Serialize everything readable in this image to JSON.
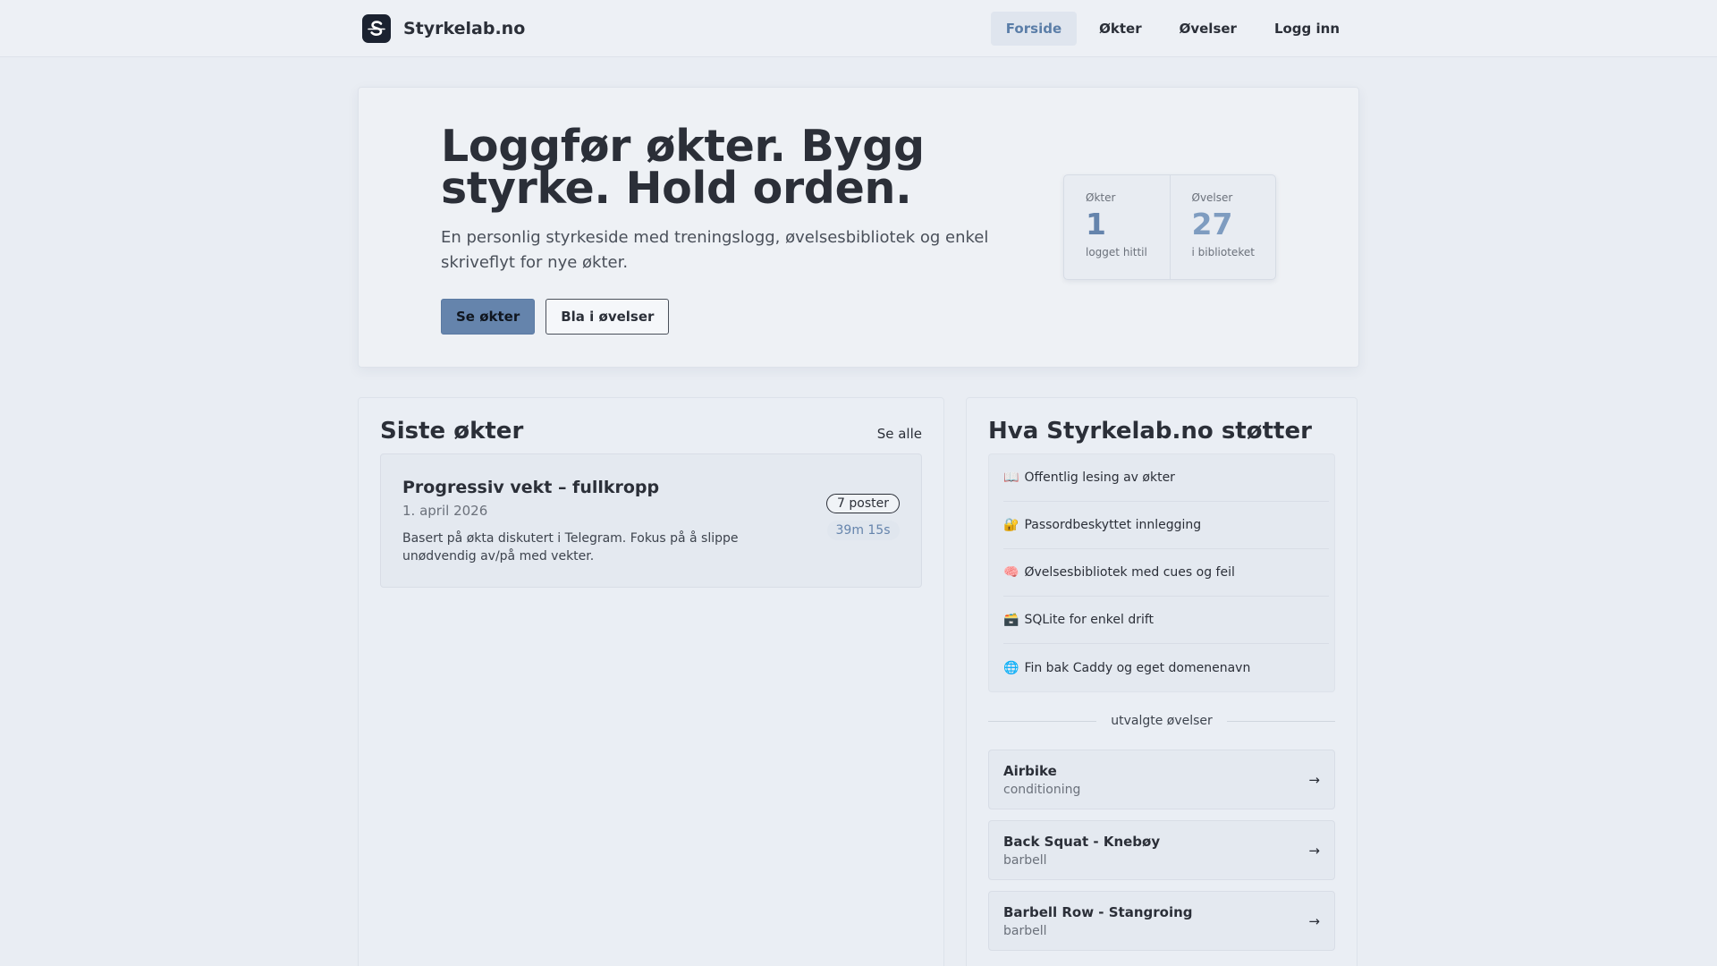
{
  "brand": {
    "name": "Styrkelab.no",
    "logo_icon": "s-logo-icon"
  },
  "nav": [
    {
      "label": "Forside",
      "active": true
    },
    {
      "label": "Økter",
      "active": false
    },
    {
      "label": "Øvelser",
      "active": false
    },
    {
      "label": "Logg inn",
      "active": false
    }
  ],
  "hero": {
    "title": "Loggfør økter. Bygg styrke. Hold orden.",
    "subtitle": "En personlig styrkeside med treningslogg, øvelsesbibliotek og enkel skriveflyt for nye økter.",
    "primary_button": "Se økter",
    "secondary_button": "Bla i øvelser",
    "stats": [
      {
        "label": "Økter",
        "value": "1",
        "sub": "logget hittil"
      },
      {
        "label": "Øvelser",
        "value": "27",
        "sub": "i biblioteket"
      }
    ]
  },
  "recent": {
    "title": "Siste økter",
    "see_all": "Se alle",
    "sessions": [
      {
        "title": "Progressiv vekt – fullkropp",
        "date": "1. april 2026",
        "description": "Basert på økta diskutert i Telegram. Fokus på å slippe unødvendig av/på med vekter.",
        "entries": "7 poster",
        "duration": "39m 15s"
      }
    ]
  },
  "features": {
    "title": "Hva Styrkelab.no støtter",
    "items": [
      {
        "icon": "📖",
        "icon_name": "book-icon",
        "label": "Offentlig lesing av økter"
      },
      {
        "icon": "🔐",
        "icon_name": "lock-icon",
        "label": "Passordbeskyttet innlegging"
      },
      {
        "icon": "🧠",
        "icon_name": "brain-icon",
        "label": "Øvelsesbibliotek med cues og feil"
      },
      {
        "icon": "🗃️",
        "icon_name": "card-box-icon",
        "label": "SQLite for enkel drift"
      },
      {
        "icon": "🌐",
        "icon_name": "globe-icon",
        "label": "Fin bak Caddy og eget domenenavn"
      }
    ],
    "divider": "utvalgte øvelser",
    "exercises": [
      {
        "name": "Airbike",
        "category": "conditioning",
        "arrow": "→"
      },
      {
        "name": "Back Squat - Knebøy",
        "category": "barbell",
        "arrow": "→"
      },
      {
        "name": "Barbell Row - Stangroing",
        "category": "barbell",
        "arrow": "→"
      }
    ]
  },
  "colors": {
    "accent": "#6584ac",
    "accent_light": "#7e9cc0",
    "text": "#2b2f38",
    "background": "#e9edf3"
  }
}
